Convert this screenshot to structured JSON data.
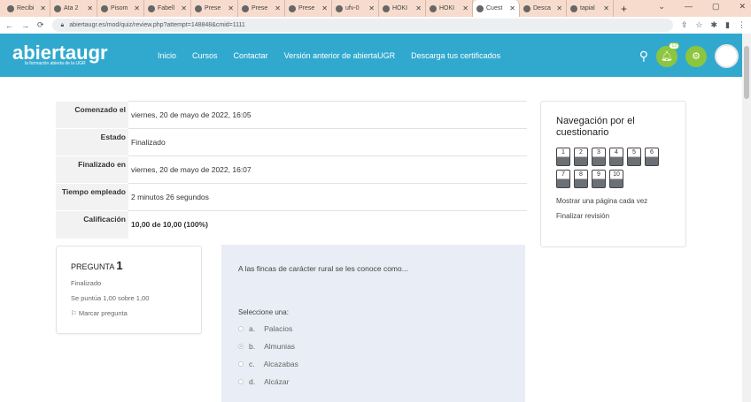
{
  "browser": {
    "tabs": [
      "Recibi",
      "Ata 2",
      "Pisom",
      "Fabell",
      "Prese",
      "Prese",
      "Prese",
      "ufv-0",
      "HOKI",
      "HOKI",
      "Cuest",
      "Desca",
      "tapial"
    ],
    "active_tab": 10,
    "url": "abiertaugr.es/mod/quiz/review.php?attempt=148848&cmid=1111"
  },
  "header": {
    "logo": "abiertaugr",
    "logo_tagline": "la formación abierta de la UGR",
    "nav": [
      "Inicio",
      "Cursos",
      "Contactar",
      "Versión anterior de abiertaUGR",
      "Descarga tus certificados"
    ],
    "notification_count": "13",
    "accent": "#31a9cf",
    "icon_color": "#8cc63e"
  },
  "summary": [
    {
      "label": "Comenzado el",
      "value": "viernes, 20 de mayo de 2022, 16:05"
    },
    {
      "label": "Estado",
      "value": "Finalizado"
    },
    {
      "label": "Finalizado en",
      "value": "viernes, 20 de mayo de 2022, 16:07"
    },
    {
      "label": "Tiempo empleado",
      "value": "2 minutos 26 segundos"
    },
    {
      "label": "Calificación",
      "value": "10,00 de 10,00 (100%)"
    }
  ],
  "question": {
    "title": "PREGUNTA",
    "number": "1",
    "state": "Finalizado",
    "grade": "Se puntúa 1,00 sobre 1,00",
    "flag": "Marcar pregunta",
    "text": "A las fincas de carácter rural se les conoce como...",
    "prompt": "Seleccione una:",
    "options": [
      {
        "letter": "a.",
        "text": "Palacios",
        "selected": false
      },
      {
        "letter": "b.",
        "text": "Almunias",
        "selected": true
      },
      {
        "letter": "c.",
        "text": "Alcazabas",
        "selected": false
      },
      {
        "letter": "d.",
        "text": "Alcázar",
        "selected": false
      }
    ]
  },
  "quiz_nav": {
    "title": "Navegación por el cuestionario",
    "buttons": [
      "1",
      "2",
      "3",
      "4",
      "5",
      "6",
      "7",
      "8",
      "9",
      "10"
    ],
    "show_one_page": "Mostrar una página cada vez",
    "finish_review": "Finalizar revisión"
  }
}
